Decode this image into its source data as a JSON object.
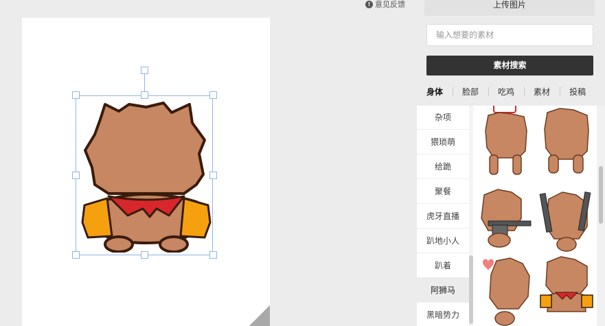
{
  "feedback": {
    "label": "意见反馈",
    "icon": "info-icon"
  },
  "panel": {
    "upload_label": "上传图片",
    "search_placeholder": "输入想要的素材",
    "search_button": "素材搜索",
    "tabs": [
      "身体",
      "脸部",
      "吃鸡",
      "素材",
      "投稿"
    ],
    "active_tab": "身体",
    "categories": [
      "杂项",
      "猥琐萌",
      "给跪",
      "聚餐",
      "虎牙直播",
      "趴地小人",
      "趴着",
      "阿狮马",
      "黑暗势力"
    ],
    "active_category": "阿狮马"
  },
  "colors": {
    "fur": "#c68762",
    "outline": "#3a1c0c",
    "scarf": "#d9262c",
    "sleeve": "#f5a10f",
    "selection": "#8fb4e8"
  }
}
